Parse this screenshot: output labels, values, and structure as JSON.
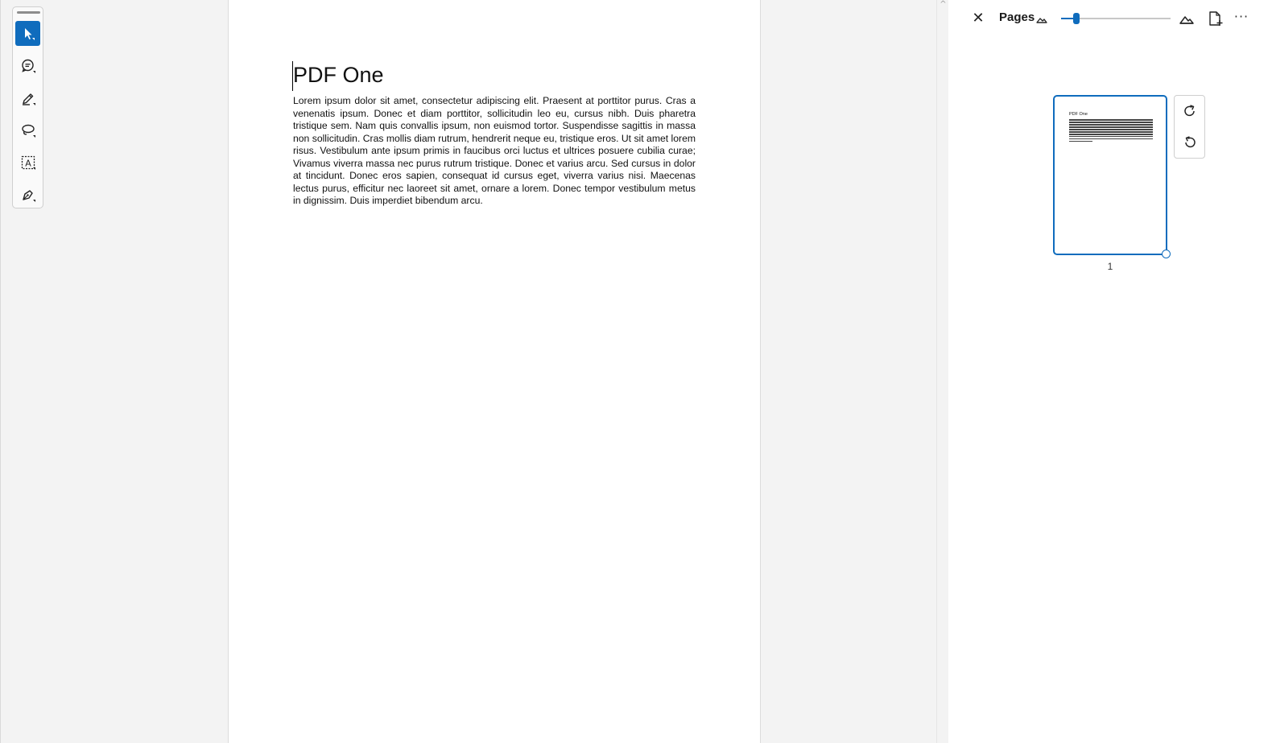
{
  "document": {
    "title": "PDF One",
    "body": "Lorem ipsum dolor sit amet, consectetur adipiscing elit. Praesent at porttitor purus. Cras a venenatis ipsum. Donec et diam porttitor, sollicitudin leo eu, cursus nibh. Duis pharetra tristique sem. Nam quis convallis ipsum, non euismod tortor. Suspendisse sagittis in massa non sollicitudin. Cras mollis diam rutrum, hendrerit neque eu, tristique eros. Ut sit amet lorem risus. Vestibulum ante ipsum primis in faucibus orci luctus et ultrices posuere cubilia curae; Vivamus viverra massa nec purus rutrum tristique. Donec et varius arcu. Sed cursus in dolor at tincidunt. Donec eros sapien, consequat id cursus eget, viverra varius nisi. Maecenas lectus purus, efficitur nec laoreet sit amet, ornare a lorem. Donec tempor vestibulum metus in dignissim. Duis imperdiet bibendum arcu."
  },
  "toolbar": {
    "tools": [
      {
        "icon": "select-cursor-icon",
        "active": true
      },
      {
        "icon": "comment-icon",
        "active": false
      },
      {
        "icon": "highlight-pen-icon",
        "active": false
      },
      {
        "icon": "lasso-icon",
        "active": false
      },
      {
        "icon": "text-box-icon",
        "active": false
      },
      {
        "icon": "draw-pen-icon",
        "active": false
      }
    ]
  },
  "pages_pane": {
    "title": "Pages",
    "close_glyph": "✕",
    "more_glyph": "···",
    "zoom_level": 0.12,
    "thumbnail": {
      "title": "PDF One",
      "page_number": "1",
      "selected": true
    }
  },
  "colors": {
    "accent": "#0f6cbd",
    "canvas": "#f3f3f3",
    "page": "#ffffff"
  }
}
